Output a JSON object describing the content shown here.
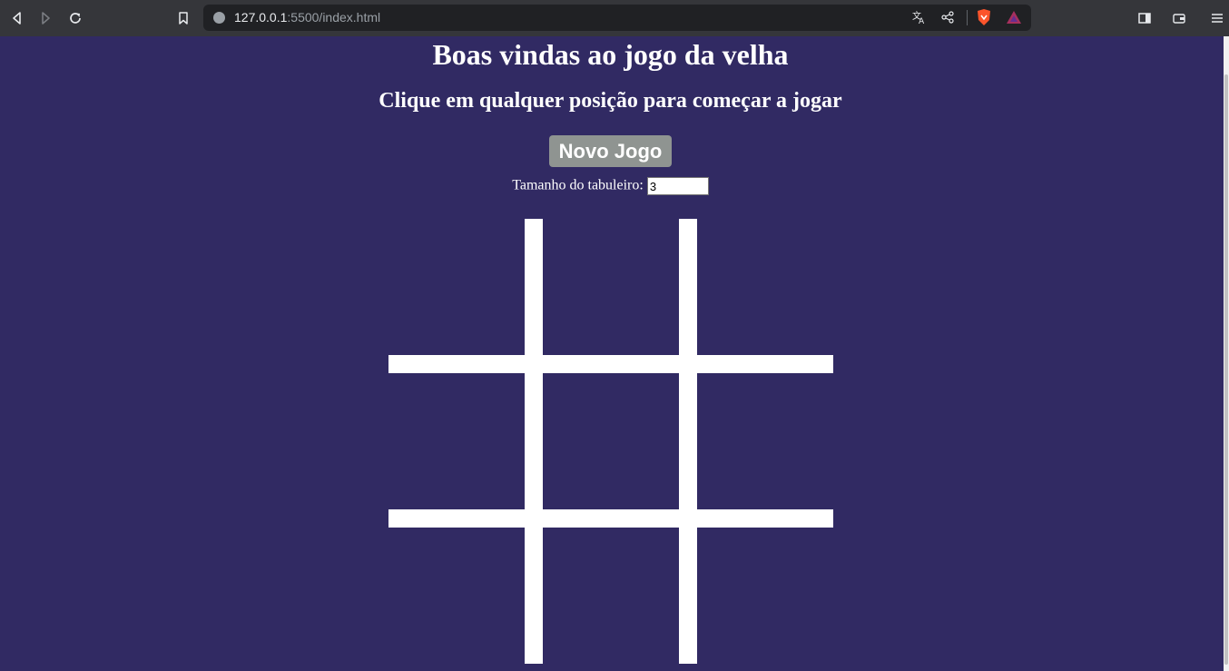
{
  "browser": {
    "url_host": "127.0.0.1",
    "url_rest": ":5500/index.html"
  },
  "page": {
    "title": "Boas vindas ao jogo da velha",
    "subtitle": "Clique em qualquer posição para começar a jogar",
    "new_game_label": "Novo Jogo",
    "board_size_label": "Tamanho do tabuleiro:",
    "board_size_value": "3"
  },
  "board": {
    "cells": [
      "",
      "",
      "",
      "",
      "",
      "",
      "",
      "",
      ""
    ]
  },
  "colors": {
    "background": "#312a63",
    "text": "#ffffff",
    "button": "#8f9491",
    "grid": "#ffffff"
  }
}
